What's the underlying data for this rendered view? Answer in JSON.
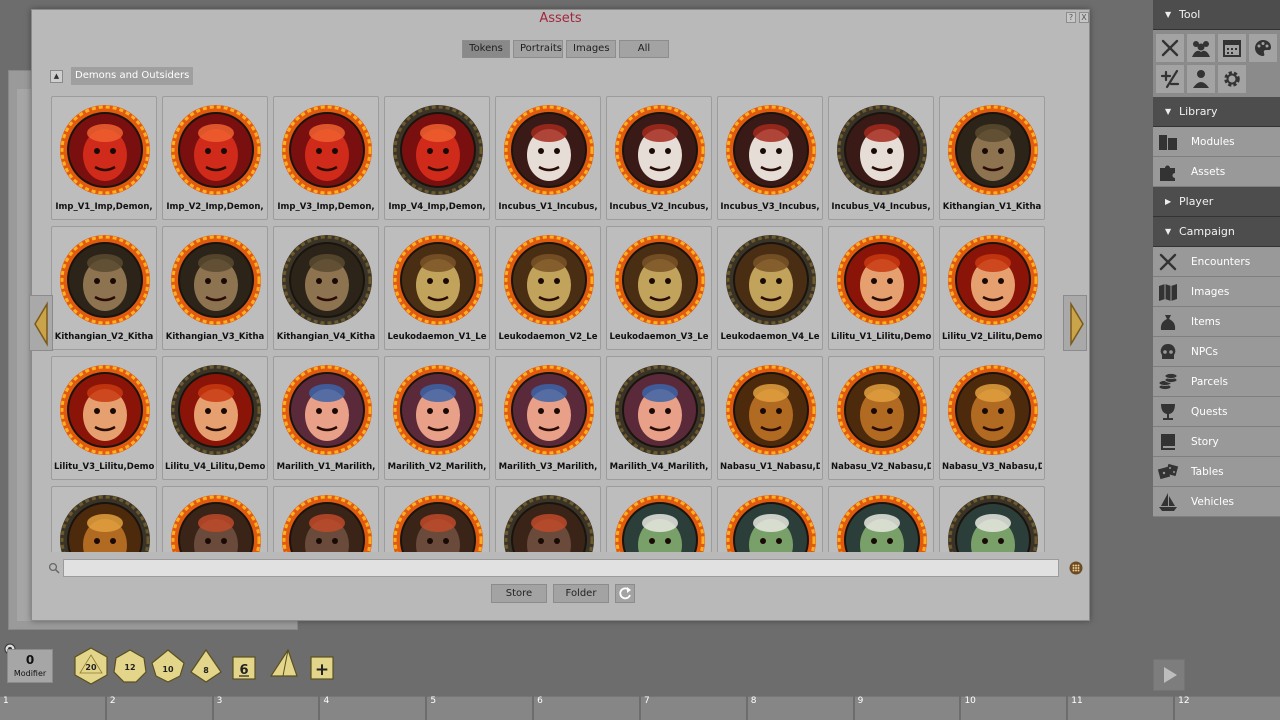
{
  "window": {
    "title": "Assets",
    "help_label": "?",
    "close_label": "X",
    "title_color": "#a3263c"
  },
  "filters": [
    {
      "label": "Tokens",
      "active": true
    },
    {
      "label": "Portraits",
      "active": false
    },
    {
      "label": "Images",
      "active": false
    },
    {
      "label": "All",
      "active": false
    }
  ],
  "group": {
    "label": "Demons and Outsiders",
    "collapse_icon": "triangle-up-icon"
  },
  "tokens": [
    {
      "name": "Imp_V1_Imp,Demon,",
      "art": "imp",
      "ring": "fire"
    },
    {
      "name": "Imp_V2_Imp,Demon,",
      "art": "imp",
      "ring": "fire"
    },
    {
      "name": "Imp_V3_Imp,Demon,",
      "art": "imp",
      "ring": "fire"
    },
    {
      "name": "Imp_V4_Imp,Demon,",
      "art": "imp",
      "ring": "dark"
    },
    {
      "name": "Incubus_V1_Incubus,",
      "art": "incubus",
      "ring": "fire"
    },
    {
      "name": "Incubus_V2_Incubus,",
      "art": "incubus",
      "ring": "fire"
    },
    {
      "name": "Incubus_V3_Incubus,",
      "art": "incubus",
      "ring": "fire"
    },
    {
      "name": "Incubus_V4_Incubus,",
      "art": "incubus",
      "ring": "dark"
    },
    {
      "name": "Kithangian_V1_Kitha",
      "art": "kithangian",
      "ring": "fire"
    },
    {
      "name": "Kithangian_V2_Kitha",
      "art": "kithangian",
      "ring": "fire"
    },
    {
      "name": "Kithangian_V3_Kitha",
      "art": "kithangian",
      "ring": "fire"
    },
    {
      "name": "Kithangian_V4_Kitha",
      "art": "kithangian",
      "ring": "dark"
    },
    {
      "name": "Leukodaemon_V1_Le",
      "art": "leukodaemon",
      "ring": "fire"
    },
    {
      "name": "Leukodaemon_V2_Le",
      "art": "leukodaemon",
      "ring": "fire"
    },
    {
      "name": "Leukodaemon_V3_Le",
      "art": "leukodaemon",
      "ring": "fire"
    },
    {
      "name": "Leukodaemon_V4_Le",
      "art": "leukodaemon",
      "ring": "dark"
    },
    {
      "name": "Lilitu_V1_Lilitu,Demo",
      "art": "lilitu",
      "ring": "fire"
    },
    {
      "name": "Lilitu_V2_Lilitu,Demo",
      "art": "lilitu",
      "ring": "fire"
    },
    {
      "name": "Lilitu_V3_Lilitu,Demo",
      "art": "lilitu",
      "ring": "fire"
    },
    {
      "name": "Lilitu_V4_Lilitu,Demo",
      "art": "lilitu",
      "ring": "dark"
    },
    {
      "name": "Marilith_V1_Marilith,",
      "art": "marilith",
      "ring": "fire"
    },
    {
      "name": "Marilith_V2_Marilith,",
      "art": "marilith",
      "ring": "fire"
    },
    {
      "name": "Marilith_V3_Marilith,",
      "art": "marilith",
      "ring": "fire"
    },
    {
      "name": "Marilith_V4_Marilith,",
      "art": "marilith",
      "ring": "dark"
    },
    {
      "name": "Nabasu_V1_Nabasu,D",
      "art": "nabasu",
      "ring": "fire"
    },
    {
      "name": "Nabasu_V2_Nabasu,D",
      "art": "nabasu",
      "ring": "fire"
    },
    {
      "name": "Nabasu_V3_Nabasu,D",
      "art": "nabasu",
      "ring": "fire"
    },
    {
      "name": "",
      "art": "nabasu",
      "ring": "dark"
    },
    {
      "name": "",
      "art": "boar",
      "ring": "fire"
    },
    {
      "name": "",
      "art": "boar",
      "ring": "fire"
    },
    {
      "name": "",
      "art": "boar",
      "ring": "fire"
    },
    {
      "name": "",
      "art": "boar",
      "ring": "dark"
    },
    {
      "name": "",
      "art": "lizard",
      "ring": "fire"
    },
    {
      "name": "",
      "art": "lizard",
      "ring": "fire"
    },
    {
      "name": "",
      "art": "lizard",
      "ring": "fire"
    },
    {
      "name": "",
      "art": "lizard",
      "ring": "dark"
    }
  ],
  "search": {
    "value": "",
    "placeholder": "",
    "search_icon": "magnifier-icon",
    "grid_icon": "grid-dots-icon"
  },
  "bottom_buttons": {
    "store": "Store",
    "folder": "Folder",
    "refresh_icon": "refresh-icon"
  },
  "sidebar": {
    "tool_header": "Tool",
    "tool_icons": [
      "swords-icon",
      "party-icon",
      "calendar-icon",
      "palette-icon",
      "modifier-icon",
      "character-icon",
      "gear-icon"
    ],
    "library_header": "Library",
    "library_items": [
      {
        "label": "Modules",
        "icon": "books-icon"
      },
      {
        "label": "Assets",
        "icon": "puzzle-icon"
      }
    ],
    "player_header": "Player",
    "campaign_header": "Campaign",
    "campaign_items": [
      {
        "label": "Encounters",
        "icon": "swords-icon"
      },
      {
        "label": "Images",
        "icon": "map-icon"
      },
      {
        "label": "Items",
        "icon": "bag-icon"
      },
      {
        "label": "NPCs",
        "icon": "skull-icon"
      },
      {
        "label": "Parcels",
        "icon": "coins-icon"
      },
      {
        "label": "Quests",
        "icon": "goblet-icon"
      },
      {
        "label": "Story",
        "icon": "book-icon"
      },
      {
        "label": "Tables",
        "icon": "dice-icon"
      },
      {
        "label": "Vehicles",
        "icon": "ship-icon"
      }
    ]
  },
  "modifier": {
    "value": "0",
    "label": "Modifier"
  },
  "dice": [
    {
      "label": "20",
      "type": "d20"
    },
    {
      "label": "12",
      "type": "d12"
    },
    {
      "label": "10",
      "type": "d10"
    },
    {
      "label": "8",
      "type": "d8"
    },
    {
      "label": "6",
      "type": "d6"
    },
    {
      "label": "",
      "type": "d4"
    },
    {
      "label": "+",
      "type": "custom"
    }
  ],
  "hotkeys": [
    "1",
    "2",
    "3",
    "4",
    "5",
    "6",
    "7",
    "8",
    "9",
    "10",
    "11",
    "12"
  ],
  "colors": {
    "window_bg": "#b9b9b9",
    "sidebar_header": "#4d4d4d",
    "sidebar_item": "#999999",
    "dice": "#e3d68a"
  }
}
